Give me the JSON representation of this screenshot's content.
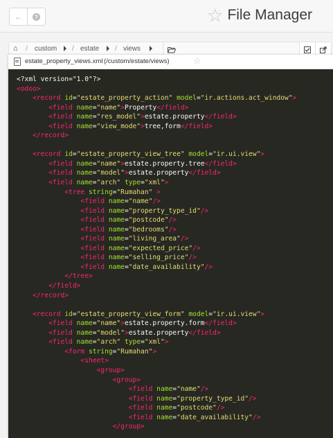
{
  "header": {
    "title": "File Manager",
    "back_icon": "arrow-left-icon",
    "help_icon": "help-icon",
    "favorite_icon": "star-icon"
  },
  "breadcrumb": {
    "home_icon": "home-icon",
    "items": [
      "custom",
      "estate",
      "views"
    ],
    "folder_icon": "folder-open-icon",
    "actions": [
      "checkbox-icon",
      "external-link-icon"
    ]
  },
  "editor": {
    "filename": "estate_property_views.xml",
    "path": "(/custom/estate/views)",
    "favorite_icon": "star-icon"
  },
  "code_lines": [
    [
      [
        "punc",
        "<?xml version=\"1.0\"?>"
      ]
    ],
    [
      [
        "tag",
        "<odoo>"
      ]
    ],
    [
      [
        "punc",
        "    "
      ],
      [
        "tag",
        "<record "
      ],
      [
        "attr",
        "id"
      ],
      [
        "punc",
        "="
      ],
      [
        "str",
        "\"estate_property_action\""
      ],
      [
        "punc",
        " "
      ],
      [
        "attr",
        "model"
      ],
      [
        "punc",
        "="
      ],
      [
        "str",
        "\"ir.actions.act_window\""
      ],
      [
        "tag",
        ">"
      ]
    ],
    [
      [
        "punc",
        "        "
      ],
      [
        "tag",
        "<field "
      ],
      [
        "attr",
        "name"
      ],
      [
        "punc",
        "="
      ],
      [
        "str",
        "\"name\""
      ],
      [
        "tag",
        ">"
      ],
      [
        "text",
        "Property"
      ],
      [
        "tag",
        "</field>"
      ]
    ],
    [
      [
        "punc",
        "        "
      ],
      [
        "tag",
        "<field "
      ],
      [
        "attr",
        "name"
      ],
      [
        "punc",
        "="
      ],
      [
        "str",
        "\"res_model\""
      ],
      [
        "tag",
        ">"
      ],
      [
        "text",
        "estate.property"
      ],
      [
        "tag",
        "</field>"
      ]
    ],
    [
      [
        "punc",
        "        "
      ],
      [
        "tag",
        "<field "
      ],
      [
        "attr",
        "name"
      ],
      [
        "punc",
        "="
      ],
      [
        "str",
        "\"view_mode\""
      ],
      [
        "tag",
        ">"
      ],
      [
        "text",
        "tree,form"
      ],
      [
        "tag",
        "</field>"
      ]
    ],
    [
      [
        "punc",
        "    "
      ],
      [
        "tag",
        "</record>"
      ]
    ],
    [
      [
        "punc",
        ""
      ]
    ],
    [
      [
        "punc",
        "    "
      ],
      [
        "tag",
        "<record "
      ],
      [
        "attr",
        "id"
      ],
      [
        "punc",
        "="
      ],
      [
        "str",
        "\"estate_property_view_tree\""
      ],
      [
        "punc",
        " "
      ],
      [
        "attr",
        "model"
      ],
      [
        "punc",
        "="
      ],
      [
        "str",
        "\"ir.ui.view\""
      ],
      [
        "tag",
        ">"
      ]
    ],
    [
      [
        "punc",
        "        "
      ],
      [
        "tag",
        "<field "
      ],
      [
        "attr",
        "name"
      ],
      [
        "punc",
        "="
      ],
      [
        "str",
        "\"name\""
      ],
      [
        "tag",
        ">"
      ],
      [
        "text",
        "estate.property.tree"
      ],
      [
        "tag",
        "</field>"
      ]
    ],
    [
      [
        "punc",
        "        "
      ],
      [
        "tag",
        "<field "
      ],
      [
        "attr",
        "name"
      ],
      [
        "punc",
        "="
      ],
      [
        "str",
        "\"model\""
      ],
      [
        "tag",
        ">"
      ],
      [
        "text",
        "estate.property"
      ],
      [
        "tag",
        "</field>"
      ]
    ],
    [
      [
        "punc",
        "        "
      ],
      [
        "tag",
        "<field "
      ],
      [
        "attr",
        "name"
      ],
      [
        "punc",
        "="
      ],
      [
        "str",
        "\"arch\""
      ],
      [
        "punc",
        " "
      ],
      [
        "attr",
        "type"
      ],
      [
        "punc",
        "="
      ],
      [
        "str",
        "\"xml\""
      ],
      [
        "tag",
        ">"
      ]
    ],
    [
      [
        "punc",
        "            "
      ],
      [
        "tag",
        "<tree "
      ],
      [
        "attr",
        "string"
      ],
      [
        "punc",
        "="
      ],
      [
        "str",
        "\"Rumahan\""
      ],
      [
        "punc",
        " "
      ],
      [
        "tag",
        ">"
      ]
    ],
    [
      [
        "punc",
        "                "
      ],
      [
        "tag",
        "<field "
      ],
      [
        "attr",
        "name"
      ],
      [
        "punc",
        "="
      ],
      [
        "str",
        "\"name\""
      ],
      [
        "tag",
        "/>"
      ]
    ],
    [
      [
        "punc",
        "                "
      ],
      [
        "tag",
        "<field "
      ],
      [
        "attr",
        "name"
      ],
      [
        "punc",
        "="
      ],
      [
        "str",
        "\"property_type_id\""
      ],
      [
        "tag",
        "/>"
      ]
    ],
    [
      [
        "punc",
        "                "
      ],
      [
        "tag",
        "<field "
      ],
      [
        "attr",
        "name"
      ],
      [
        "punc",
        "="
      ],
      [
        "str",
        "\"postcode\""
      ],
      [
        "tag",
        "/>"
      ]
    ],
    [
      [
        "punc",
        "                "
      ],
      [
        "tag",
        "<field "
      ],
      [
        "attr",
        "name"
      ],
      [
        "punc",
        "="
      ],
      [
        "str",
        "\"bedrooms\""
      ],
      [
        "tag",
        "/>"
      ]
    ],
    [
      [
        "punc",
        "                "
      ],
      [
        "tag",
        "<field "
      ],
      [
        "attr",
        "name"
      ],
      [
        "punc",
        "="
      ],
      [
        "str",
        "\"living_area\""
      ],
      [
        "tag",
        "/>"
      ]
    ],
    [
      [
        "punc",
        "                "
      ],
      [
        "tag",
        "<field "
      ],
      [
        "attr",
        "name"
      ],
      [
        "punc",
        "="
      ],
      [
        "str",
        "\"expected_price\""
      ],
      [
        "tag",
        "/>"
      ]
    ],
    [
      [
        "punc",
        "                "
      ],
      [
        "tag",
        "<field "
      ],
      [
        "attr",
        "name"
      ],
      [
        "punc",
        "="
      ],
      [
        "str",
        "\"selling_price\""
      ],
      [
        "tag",
        "/>"
      ]
    ],
    [
      [
        "punc",
        "                "
      ],
      [
        "tag",
        "<field "
      ],
      [
        "attr",
        "name"
      ],
      [
        "punc",
        "="
      ],
      [
        "str",
        "\"date_availability\""
      ],
      [
        "tag",
        "/>"
      ]
    ],
    [
      [
        "punc",
        "            "
      ],
      [
        "tag",
        "</tree>"
      ]
    ],
    [
      [
        "punc",
        "        "
      ],
      [
        "tag",
        "</field>"
      ]
    ],
    [
      [
        "punc",
        "    "
      ],
      [
        "tag",
        "</record>"
      ]
    ],
    [
      [
        "punc",
        ""
      ]
    ],
    [
      [
        "punc",
        "    "
      ],
      [
        "tag",
        "<record "
      ],
      [
        "attr",
        "id"
      ],
      [
        "punc",
        "="
      ],
      [
        "str",
        "\"estate_property_view_form\""
      ],
      [
        "punc",
        " "
      ],
      [
        "attr",
        "model"
      ],
      [
        "punc",
        "="
      ],
      [
        "str",
        "\"ir.ui.view\""
      ],
      [
        "tag",
        ">"
      ]
    ],
    [
      [
        "punc",
        "        "
      ],
      [
        "tag",
        "<field "
      ],
      [
        "attr",
        "name"
      ],
      [
        "punc",
        "="
      ],
      [
        "str",
        "\"name\""
      ],
      [
        "tag",
        ">"
      ],
      [
        "text",
        "estate.property.form"
      ],
      [
        "tag",
        "</field>"
      ]
    ],
    [
      [
        "punc",
        "        "
      ],
      [
        "tag",
        "<field "
      ],
      [
        "attr",
        "name"
      ],
      [
        "punc",
        "="
      ],
      [
        "str",
        "\"model\""
      ],
      [
        "tag",
        ">"
      ],
      [
        "text",
        "estate.property"
      ],
      [
        "tag",
        "</field>"
      ]
    ],
    [
      [
        "punc",
        "        "
      ],
      [
        "tag",
        "<field "
      ],
      [
        "attr",
        "name"
      ],
      [
        "punc",
        "="
      ],
      [
        "str",
        "\"arch\""
      ],
      [
        "punc",
        " "
      ],
      [
        "attr",
        "type"
      ],
      [
        "punc",
        "="
      ],
      [
        "str",
        "\"xml\""
      ],
      [
        "tag",
        ">"
      ]
    ],
    [
      [
        "punc",
        "            "
      ],
      [
        "tag",
        "<form "
      ],
      [
        "attr",
        "string"
      ],
      [
        "punc",
        "="
      ],
      [
        "str",
        "\"Rumahan\""
      ],
      [
        "tag",
        ">"
      ]
    ],
    [
      [
        "punc",
        "                "
      ],
      [
        "tag",
        "<sheet>"
      ]
    ],
    [
      [
        "punc",
        "                    "
      ],
      [
        "tag",
        "<group>"
      ]
    ],
    [
      [
        "punc",
        "                        "
      ],
      [
        "tag",
        "<group>"
      ]
    ],
    [
      [
        "punc",
        "                            "
      ],
      [
        "tag",
        "<field "
      ],
      [
        "attr",
        "name"
      ],
      [
        "punc",
        "="
      ],
      [
        "str",
        "\"name\""
      ],
      [
        "tag",
        "/>"
      ]
    ],
    [
      [
        "punc",
        "                            "
      ],
      [
        "tag",
        "<field "
      ],
      [
        "attr",
        "name"
      ],
      [
        "punc",
        "="
      ],
      [
        "str",
        "\"property_type_id\""
      ],
      [
        "tag",
        "/>"
      ]
    ],
    [
      [
        "punc",
        "                            "
      ],
      [
        "tag",
        "<field "
      ],
      [
        "attr",
        "name"
      ],
      [
        "punc",
        "="
      ],
      [
        "str",
        "\"postcode\""
      ],
      [
        "tag",
        "/>"
      ]
    ],
    [
      [
        "punc",
        "                            "
      ],
      [
        "tag",
        "<field "
      ],
      [
        "attr",
        "name"
      ],
      [
        "punc",
        "="
      ],
      [
        "str",
        "\"date_availability\""
      ],
      [
        "tag",
        "/>"
      ]
    ],
    [
      [
        "punc",
        "                        "
      ],
      [
        "tag",
        "</group>"
      ]
    ]
  ],
  "colors": {
    "editor_bg": "#272822",
    "tag": "#f92672",
    "attr": "#a6e22e",
    "string": "#e6db74",
    "text": "#f8f8f2"
  }
}
